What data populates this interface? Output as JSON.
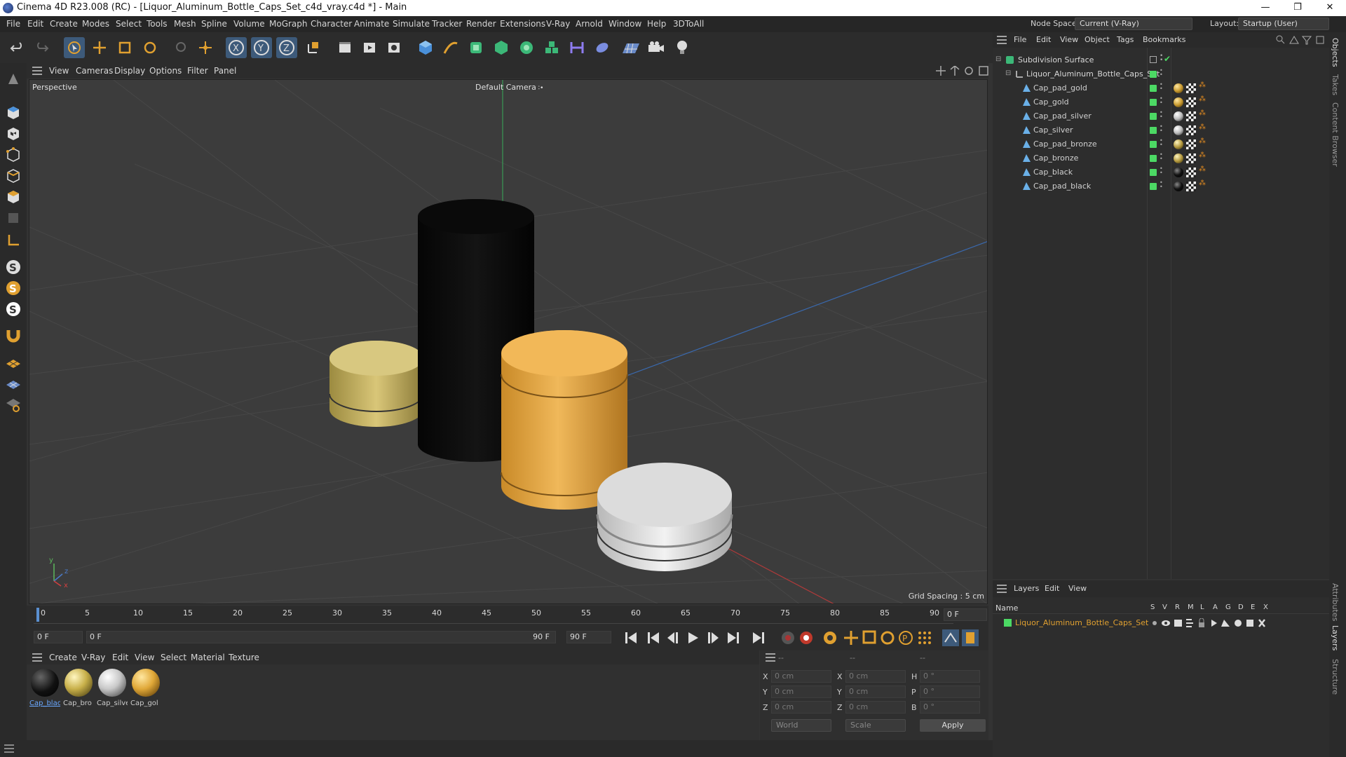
{
  "window": {
    "title": "Cinema 4D R23.008 (RC) - [Liquor_Aluminum_Bottle_Caps_Set_c4d_vray.c4d *] - Main",
    "minimize": "—",
    "maximize": "❐",
    "close": "✕"
  },
  "menubar": {
    "items": [
      "File",
      "Edit",
      "Create",
      "Modes",
      "Select",
      "Tools",
      "Mesh",
      "Spline",
      "Volume",
      "MoGraph",
      "Character",
      "Animate",
      "Simulate",
      "Tracker",
      "Render",
      "Extensions",
      "V-Ray",
      "Arnold",
      "Window",
      "Help",
      "3DToAll"
    ],
    "node_space_label": "Node Space:",
    "node_space_value": "Current (V-Ray)",
    "layout_label": "Layout:",
    "layout_value": "Startup (User)"
  },
  "viewport": {
    "menu": [
      "View",
      "Cameras",
      "Display",
      "Options",
      "Filter",
      "Panel"
    ],
    "label": "Perspective",
    "camera": "Default Camera",
    "grid_spacing": "Grid Spacing : 5 cm",
    "axis_y": "y",
    "axis_z": "z",
    "axis_x": "x"
  },
  "timeline": {
    "ticks": [
      "0",
      "5",
      "10",
      "15",
      "20",
      "25",
      "30",
      "35",
      "40",
      "45",
      "50",
      "55",
      "60",
      "65",
      "70",
      "75",
      "80",
      "85",
      "90"
    ],
    "end_frame": "0 F"
  },
  "transport": {
    "start": "0 F",
    "current": "0 F",
    "range_end": "90 F",
    "end": "90 F"
  },
  "materials": {
    "menu": [
      "Create",
      "V-Ray",
      "Edit",
      "View",
      "Select",
      "Material",
      "Texture"
    ],
    "items": [
      {
        "name": "Cap_blac",
        "color": "#111"
      },
      {
        "name": "Cap_bro",
        "color": "#c8b04a"
      },
      {
        "name": "Cap_silve",
        "color": "#d0d0d0"
      },
      {
        "name": "Cap_gol",
        "color": "#e0a838"
      }
    ]
  },
  "coords": {
    "header": [
      "--",
      "--",
      "--"
    ],
    "rows": [
      {
        "a": "X",
        "av": "0 cm",
        "b": "X",
        "bv": "0 cm",
        "c": "H",
        "cv": "0 °"
      },
      {
        "a": "Y",
        "av": "0 cm",
        "b": "Y",
        "bv": "0 cm",
        "c": "P",
        "cv": "0 °"
      },
      {
        "a": "Z",
        "av": "0 cm",
        "b": "Z",
        "bv": "0 cm",
        "c": "B",
        "cv": "0 °"
      }
    ],
    "world": "World",
    "scale": "Scale",
    "apply": "Apply"
  },
  "objects": {
    "menu": [
      "File",
      "Edit",
      "View",
      "Object",
      "Tags",
      "Bookmarks"
    ],
    "root": "Subdivision Surface",
    "group": "Liquor_Aluminum_Bottle_Caps_Set",
    "items": [
      {
        "name": "Cap_pad_gold",
        "mat": "#c89a30"
      },
      {
        "name": "Cap_gold",
        "mat": "#c89a30"
      },
      {
        "name": "Cap_pad_silver",
        "mat": "#bbb"
      },
      {
        "name": "Cap_silver",
        "mat": "#bbb"
      },
      {
        "name": "Cap_pad_bronze",
        "mat": "#b59a40"
      },
      {
        "name": "Cap_bronze",
        "mat": "#b59a40"
      },
      {
        "name": "Cap_black",
        "mat": "#111"
      },
      {
        "name": "Cap_pad_black",
        "mat": "#111"
      }
    ]
  },
  "layers": {
    "menu": [
      "Layers",
      "Edit",
      "View"
    ],
    "name_header": "Name",
    "cols": [
      "S",
      "V",
      "R",
      "M",
      "L",
      "A",
      "G",
      "D",
      "E",
      "X"
    ],
    "layer": "Liquor_Aluminum_Bottle_Caps_Set"
  },
  "rightstrip": {
    "tabs": [
      "Objects",
      "Takes",
      "Content Browser",
      "Attributes",
      "Layers",
      "Structure"
    ]
  }
}
